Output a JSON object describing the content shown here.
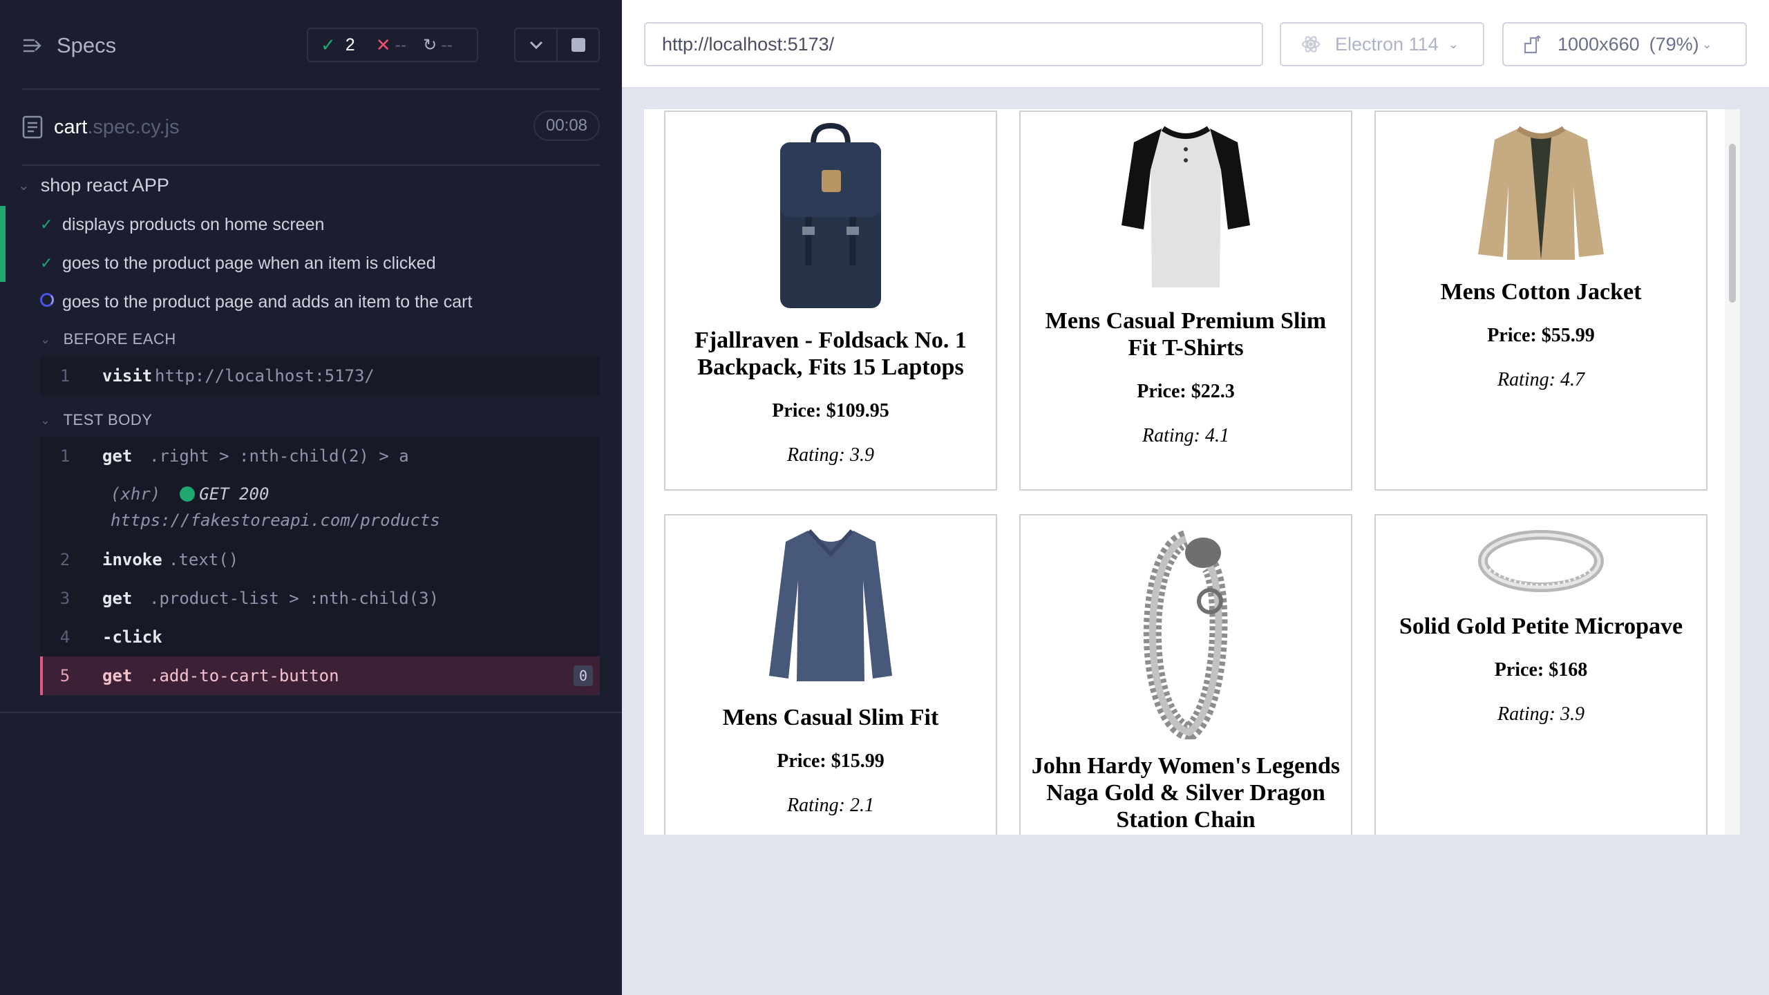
{
  "reporter": {
    "specs_label": "Specs",
    "stats": {
      "passed": "2",
      "failed": "--",
      "pending": "--"
    },
    "file": {
      "name": "cart",
      "ext": ".spec.cy.js",
      "time": "00:08"
    },
    "suite": "shop react APP",
    "tests": [
      {
        "title": "displays products on home screen",
        "state": "passed"
      },
      {
        "title": "goes to the product page when an item is clicked",
        "state": "passed"
      },
      {
        "title": "goes to the product page and adds an item to the cart",
        "state": "running"
      }
    ],
    "before_each": {
      "label": "BEFORE EACH",
      "commands": [
        {
          "num": "1",
          "name": "visit",
          "arg": "http://localhost:5173/"
        }
      ]
    },
    "test_body": {
      "label": "TEST BODY",
      "commands": [
        {
          "num": "1",
          "name": "get",
          "arg": ".right > :nth-child(2) > a"
        },
        {
          "num": "2",
          "name": "invoke",
          "arg": ".text()"
        },
        {
          "num": "3",
          "name": "get",
          "arg": ".product-list > :nth-child(3)"
        },
        {
          "num": "4",
          "name": "-click",
          "arg": ""
        },
        {
          "num": "5",
          "name": "get",
          "arg": ".add-to-cart-button",
          "badge": "0"
        }
      ],
      "xhr": {
        "type": "(xhr)",
        "method_status": "GET 200",
        "url": "https://fakestoreapi.com/products"
      }
    }
  },
  "aut": {
    "url": "http://localhost:5173/",
    "browser": "Electron 114",
    "viewport": "1000x660",
    "zoom": "(79%)"
  },
  "products": [
    {
      "title": "Fjallraven - Foldsack No. 1 Backpack, Fits 15 Laptops",
      "price": "Price: $109.95",
      "rating": "Rating: 3.9",
      "icon": "backpack-image"
    },
    {
      "title": "Mens Casual Premium Slim Fit T-Shirts",
      "price": "Price: $22.3",
      "rating": "Rating: 4.1",
      "icon": "tshirt-image"
    },
    {
      "title": "Mens Cotton Jacket",
      "price": "Price: $55.99",
      "rating": "Rating: 4.7",
      "icon": "jacket-image"
    },
    {
      "title": "Mens Casual Slim Fit",
      "price": "Price: $15.99",
      "rating": "Rating: 2.1",
      "icon": "longsleeve-image"
    },
    {
      "title": "John Hardy Women's Legends Naga Gold & Silver Dragon Station Chain",
      "price": "",
      "rating": "",
      "icon": "bracelet-image"
    },
    {
      "title": "Solid Gold Petite Micropave",
      "price": "Price: $168",
      "rating": "Rating: 3.9",
      "icon": "ring-image"
    }
  ],
  "colors": {
    "sidebar_bg": "#1b1e2e",
    "pass": "#1fa971",
    "fail": "#f0506e",
    "active_cmd": "#3b2036"
  }
}
